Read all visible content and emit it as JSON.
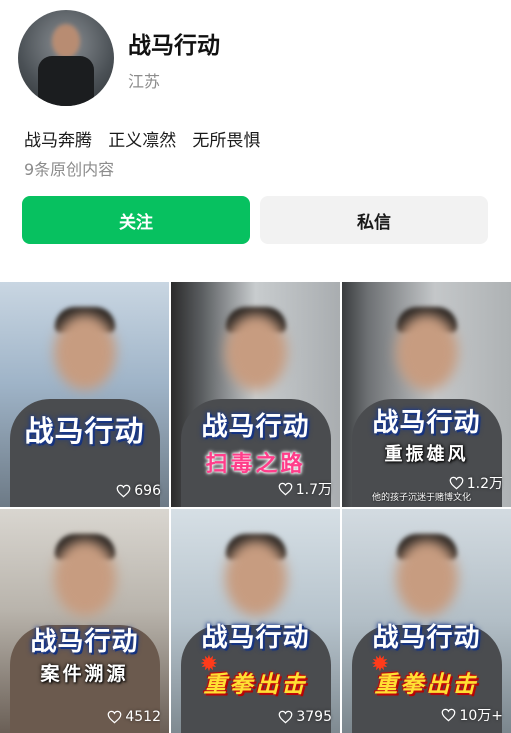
{
  "profile": {
    "name": "战马行动",
    "location": "江苏",
    "bio": "战马奔腾   正义凛然   无所畏惧",
    "post_count": "9条原创内容"
  },
  "actions": {
    "follow_label": "关注",
    "message_label": "私信"
  },
  "colors": {
    "follow_green": "#07c160",
    "message_gray": "#f2f2f2"
  },
  "videos": [
    {
      "title": "战马行动",
      "subtitle": "",
      "caption": "",
      "likes": "696"
    },
    {
      "title": "战马行动",
      "subtitle": "扫毒之路",
      "caption": "",
      "likes": "1.7万"
    },
    {
      "title": "战马行动",
      "subtitle": "重振雄风",
      "caption": "他的孩子沉迷于赌博文化",
      "likes": "1.2万"
    },
    {
      "title": "战马行动",
      "subtitle": "案件溯源",
      "caption": "",
      "likes": "4512"
    },
    {
      "title": "战马行动",
      "subtitle": "重拳出击",
      "caption": "",
      "likes": "3795"
    },
    {
      "title": "战马行动",
      "subtitle": "重拳出击",
      "caption": "",
      "likes": "10万+"
    }
  ],
  "icons": {
    "like": "heart-outline-icon",
    "burst": "explosion-icon"
  }
}
